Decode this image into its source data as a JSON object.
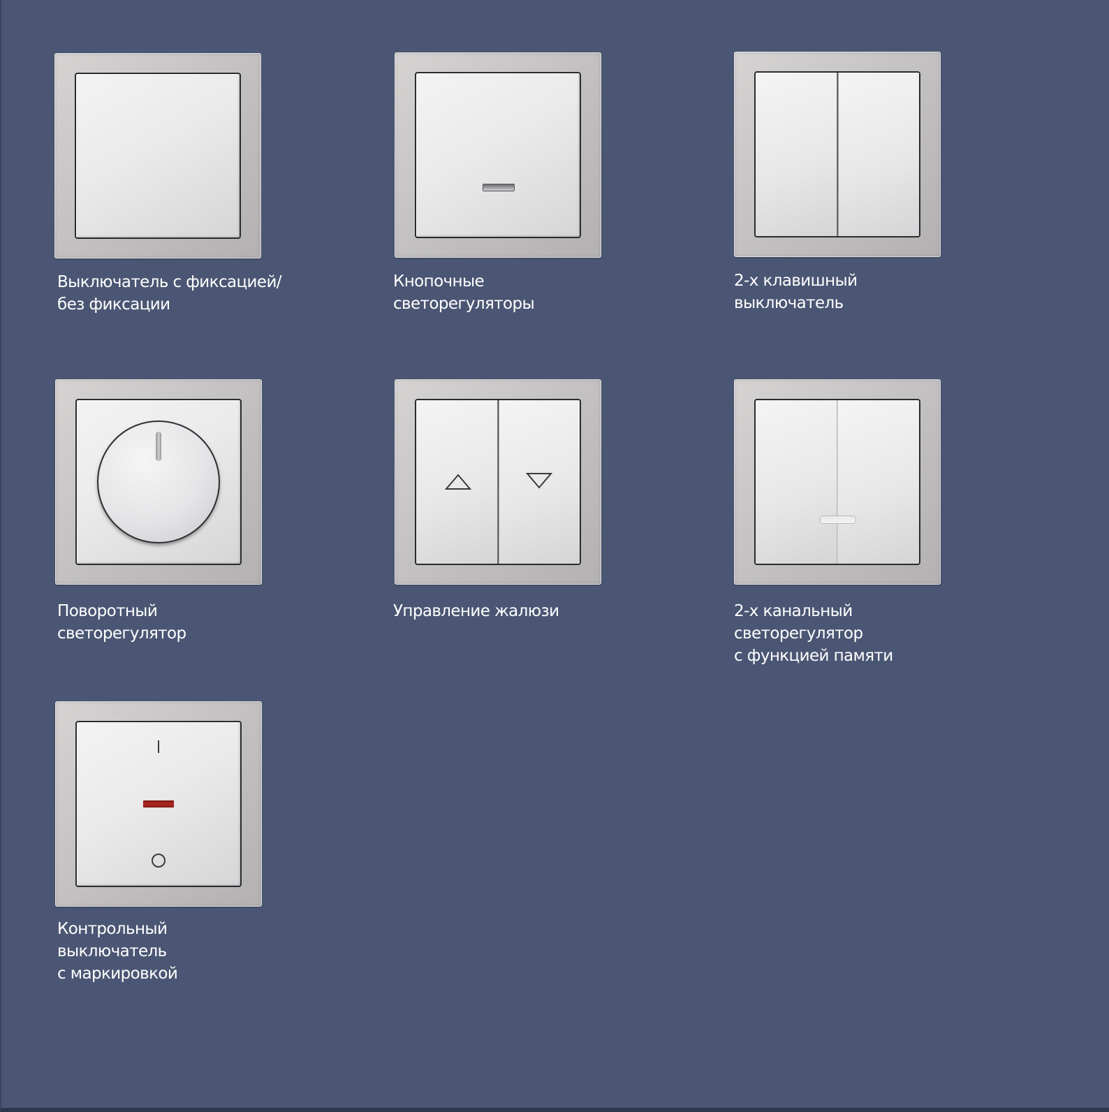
{
  "colors": {
    "background": "#4a5673",
    "frame": "#c4c2c2",
    "plate": "#ebeaeb",
    "indicator_red": "#b02a24"
  },
  "products": [
    {
      "id": "latching-switch",
      "caption_lines": [
        "Выключатель с фиксацией/",
        "без фиксации"
      ],
      "icons": []
    },
    {
      "id": "push-dimmer",
      "caption_lines": [
        "Кнопочные",
        "светорегуляторы"
      ],
      "icons": [
        "indicator-slot-icon"
      ]
    },
    {
      "id": "two-gang-switch",
      "caption_lines": [
        "2-х клавишный",
        "выключатель"
      ],
      "icons": [
        "rocker-split-icon"
      ]
    },
    {
      "id": "rotary-dimmer",
      "caption_lines": [
        "Поворотный",
        "светорегулятор"
      ],
      "icons": [
        "rotary-knob-icon"
      ]
    },
    {
      "id": "blind-control",
      "caption_lines": [
        "Управление жалюзи"
      ],
      "icons": [
        "arrow-up-icon",
        "arrow-down-icon"
      ]
    },
    {
      "id": "two-channel-dimmer",
      "caption_lines": [
        "2-х канальный",
        "светорегулятор",
        "с функцией памяти"
      ],
      "icons": [
        "indicator-slot-icon"
      ]
    },
    {
      "id": "control-switch",
      "caption_lines": [
        "Контрольный",
        "выключатель",
        "с маркировкой"
      ],
      "icons": [
        "on-mark-icon",
        "red-indicator-icon",
        "off-mark-icon"
      ]
    }
  ]
}
